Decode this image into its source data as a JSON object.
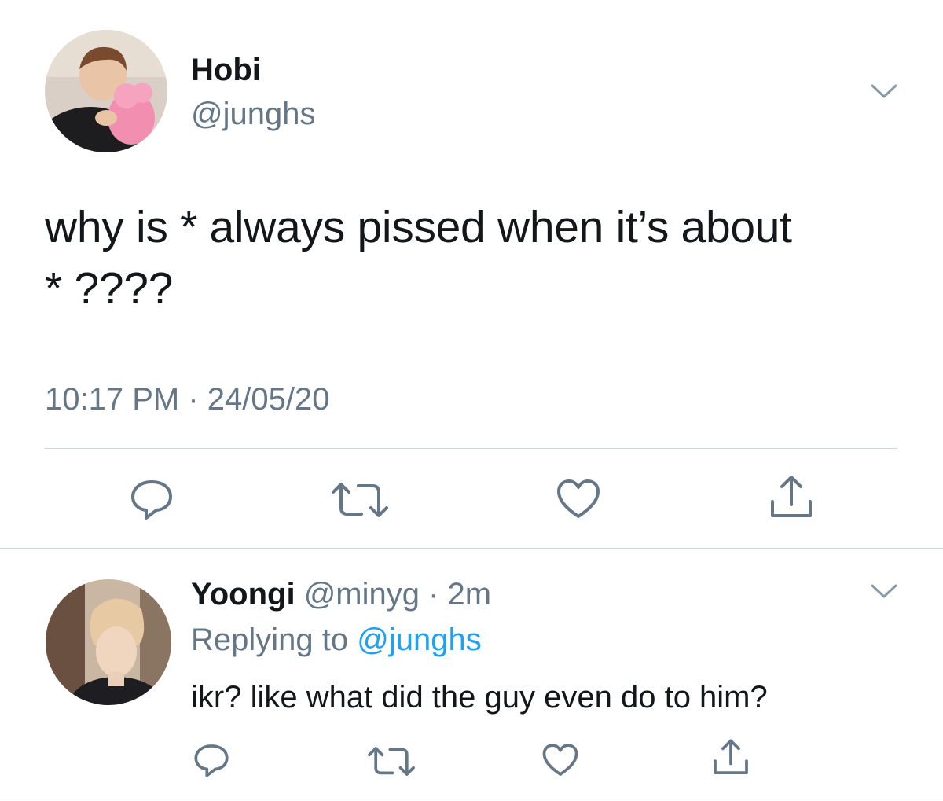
{
  "tweet": {
    "author": {
      "display_name": "Hobi",
      "handle": "@junghs",
      "avatar": "avatar-photo"
    },
    "text_lines": [
      "why is * always pissed when it’s about",
      "* ????"
    ],
    "timestamp": "10:17 PM · 24/05/20",
    "actions": [
      "reply-icon",
      "retweet-icon",
      "like-icon",
      "share-icon"
    ]
  },
  "reply": {
    "author": {
      "display_name": "Yoongi",
      "handle": "@minyg",
      "separator": " · ",
      "time_ago": "2m",
      "avatar": "avatar-photo"
    },
    "replying_to_label": "Replying to",
    "replying_to_handle": "@junghs",
    "text": "ikr? like what did the guy even do to him?",
    "actions": [
      "reply-icon",
      "retweet-icon",
      "like-icon",
      "share-icon"
    ]
  },
  "colors": {
    "text_primary": "#14171a",
    "text_secondary": "#657786",
    "link": "#1da1f2",
    "divider": "#ccd6dd"
  }
}
